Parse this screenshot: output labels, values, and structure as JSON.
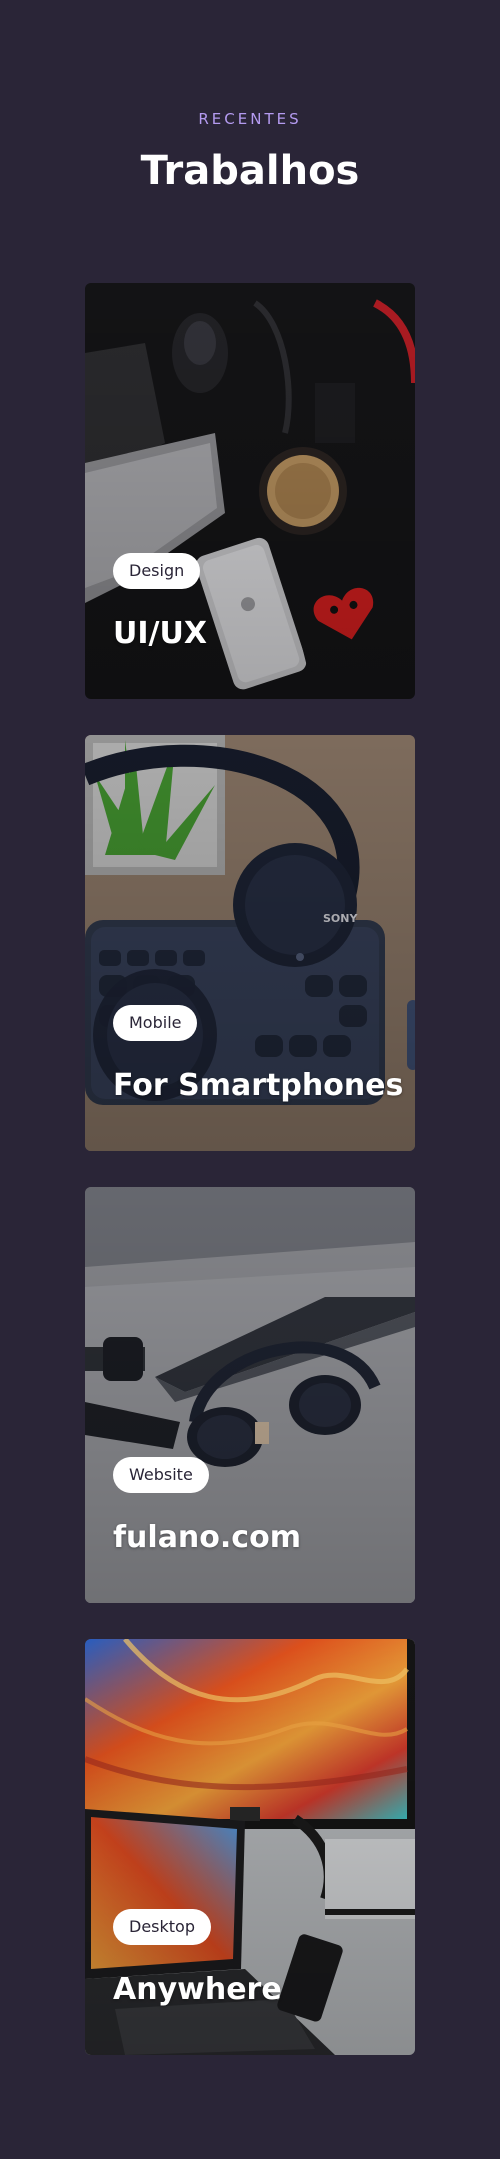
{
  "section": {
    "eyebrow": "RECENTES",
    "title": "Trabalhos"
  },
  "cards": [
    {
      "tag": "Design",
      "title": "UI/UX",
      "image": "desk-with-phone-and-coffee"
    },
    {
      "tag": "Mobile",
      "title": "For Smartphones",
      "image": "headphones-on-keyboard"
    },
    {
      "tag": "Website",
      "title": "fulano.com",
      "image": "headphones-and-smartwatch-on-desk"
    },
    {
      "tag": "Desktop",
      "title": "Anywhere",
      "image": "monitor-and-laptop-colorful-wallpaper"
    }
  ],
  "colors": {
    "background": "#2a2537",
    "accent": "#b49bf0",
    "text": "#ffffff"
  }
}
